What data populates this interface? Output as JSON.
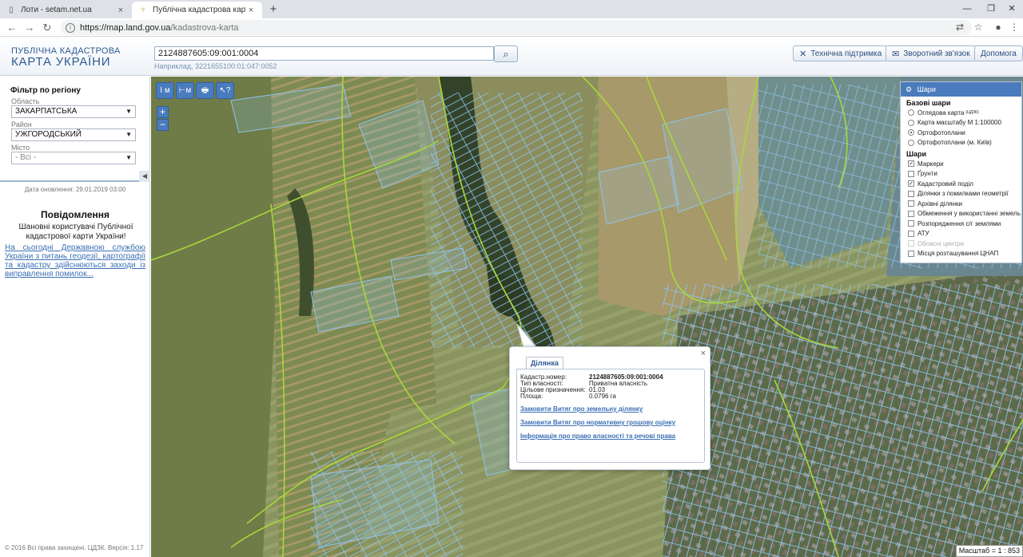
{
  "browser": {
    "tabs": [
      {
        "title": "Лоти - setam.net.ua",
        "close": "×"
      },
      {
        "title": "Публічна кадастрова карта Укр",
        "close": "×"
      }
    ],
    "new_tab": "+",
    "url_host": "https://map.land.gov.ua",
    "url_path": "/kadastrova-karta"
  },
  "header": {
    "logo_line1": "ПУБЛІЧНА КАДАСТРОВА",
    "logo_line2": "КАРТА УКРАЇНИ",
    "search_value": "2124887605:09:001:0004",
    "search_hint": "Наприклад, 3221655100:01:047:0052",
    "support_label": "Технічна підтримка",
    "feedback_label": "Зворотний зв'язок",
    "help_label": "Допомога"
  },
  "sidebar": {
    "filter_title": "Фільтр по регіону",
    "oblast_label": "Область",
    "oblast_value": "ЗАКАРПАТСЬКА",
    "rayon_label": "Район",
    "rayon_value": "УЖГОРОДСЬКИЙ",
    "misto_label": "Місто",
    "misto_value": "- Всі -",
    "update_date": "Дата оновлення: 29.01.2019 03:00",
    "notice_title": "Повідомлення",
    "notice_text": "Шановні користувачі Публічної кадастрової карти України!",
    "notice_link": "На сьогодні Державною службою України з питань геодезії, картографії та кадастру здійснюються заходи із виправлення помилок...",
    "copyright": "© 2016 Всі права захищені. ЦДЗК. Версія: 1.17"
  },
  "map": {
    "tools": [
      "I м",
      "⊢м",
      "🖶",
      "↖?"
    ],
    "zoom_in": "+",
    "zoom_out": "−",
    "scale": "Масштаб = 1 : 853"
  },
  "layers": {
    "title": "Шари",
    "base_title": "Базові шари",
    "base": [
      {
        "label": "Оглядова карта",
        "sup": "(ЦДЗК)",
        "selected": false
      },
      {
        "label": "Карта масштабу М 1:100000",
        "selected": false
      },
      {
        "label": "Ортофотоплани",
        "selected": true
      },
      {
        "label": "Ортофотоплани (м. Київ)",
        "selected": false
      }
    ],
    "layers_title": "Шари",
    "items": [
      {
        "label": "Маркери",
        "checked": true,
        "disabled": false
      },
      {
        "label": "Ґрунти",
        "checked": false,
        "disabled": false
      },
      {
        "label": "Кадастровий поділ",
        "checked": true,
        "disabled": false
      },
      {
        "label": "Ділянки з помилками геометрії",
        "checked": false,
        "disabled": false
      },
      {
        "label": "Архівні ділянки",
        "checked": false,
        "disabled": false
      },
      {
        "label": "Обмеження у використанні земель",
        "checked": false,
        "disabled": false
      },
      {
        "label": "Розпорядження с/г землями",
        "checked": false,
        "disabled": false
      },
      {
        "label": "АТУ",
        "checked": false,
        "disabled": false
      },
      {
        "label": "Обласні центри",
        "checked": false,
        "disabled": true
      },
      {
        "label": "Місця розташування ЦНАП",
        "checked": false,
        "disabled": false
      }
    ]
  },
  "popup": {
    "tab": "Ділянка",
    "rows": [
      {
        "key": "Кадастр.номер:",
        "value": "2124887605:09:001:0004"
      },
      {
        "key": "Тип власності:",
        "value": "Приватна власність"
      },
      {
        "key": "Цільове призначення:",
        "value": "01.03"
      },
      {
        "key": "Площа:",
        "value": "0.0796 га"
      }
    ],
    "links": [
      "Замовити Витяг про земельну ділянку",
      "Замовити Витяг про нормативну грошову оцінку",
      "Інформація про право власності та речові права"
    ],
    "close": "×"
  },
  "colors": {
    "accent": "#4a7bbd",
    "brand": "#2d5a93",
    "parcel_stroke": "#8fc3ec",
    "boundary": "#a8d83a"
  }
}
